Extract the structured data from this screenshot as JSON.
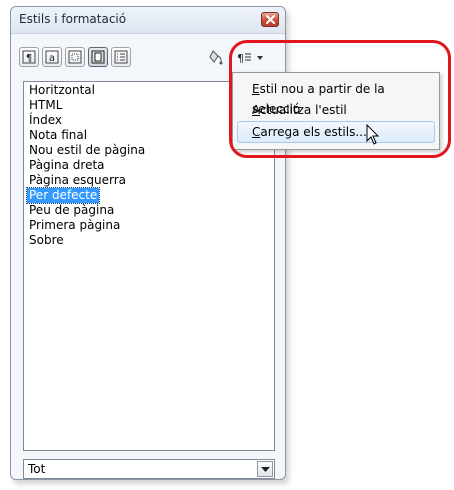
{
  "window": {
    "title": "Estils i formatació",
    "close_icon": "close-icon"
  },
  "toolbar": {
    "buttons": [
      {
        "name": "paragraph-styles-icon",
        "active": false
      },
      {
        "name": "character-styles-icon",
        "active": false
      },
      {
        "name": "frame-styles-icon",
        "active": false
      },
      {
        "name": "page-styles-icon",
        "active": true
      },
      {
        "name": "list-styles-icon",
        "active": false
      }
    ],
    "fill_format_icon": "fill-format-icon",
    "new_style_menu_icon": "new-style-menu-icon"
  },
  "styles_list": {
    "items": [
      "Horitzontal",
      "HTML",
      "Índex",
      "Nota final",
      "Nou estil de pàgina",
      "Pàgina dreta",
      "Pàgina esquerra",
      "Per defecte",
      "Peu de pàgina",
      "Primera pàgina",
      "Sobre"
    ],
    "selected": "Per defecte"
  },
  "filter": {
    "value": "Tot"
  },
  "menu": {
    "items": [
      {
        "first_letter": "E",
        "rest": "stil nou a partir de la selecció"
      },
      {
        "first_letter": "A",
        "rest": "ctualitza l'estil"
      },
      {
        "first_letter": "C",
        "rest": "arrega els estils..."
      }
    ],
    "hovered_index": 2
  },
  "colors": {
    "selection": "#3399ff",
    "highlight": "#e2151c"
  }
}
